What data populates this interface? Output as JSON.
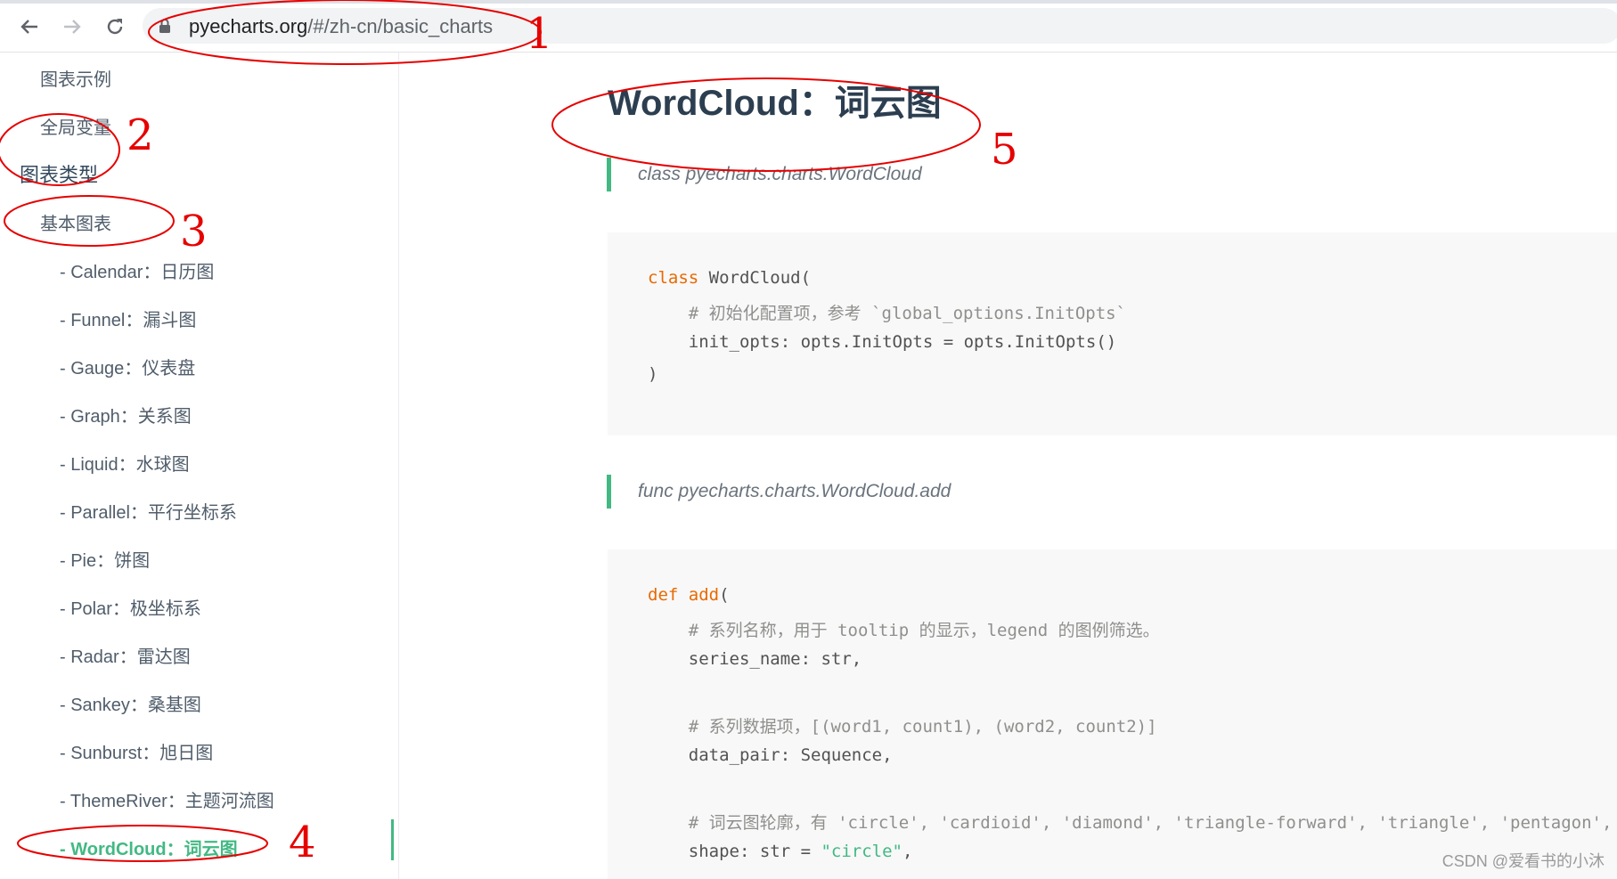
{
  "browser": {
    "back_icon": "arrow-left-icon",
    "forward_icon": "arrow-right-icon",
    "reload_icon": "reload-icon",
    "url_domain": "pyecharts.org",
    "url_path": "/#/zh-cn/basic_charts"
  },
  "sidebar": {
    "items": [
      {
        "label": "图表示例"
      },
      {
        "label": "全局变量"
      },
      {
        "label": "图表类型"
      },
      {
        "label": "基本图表"
      },
      {
        "label": "- Calendar：日历图"
      },
      {
        "label": "- Funnel：漏斗图"
      },
      {
        "label": "- Gauge：仪表盘"
      },
      {
        "label": "- Graph：关系图"
      },
      {
        "label": "- Liquid：水球图"
      },
      {
        "label": "- Parallel：平行坐标系"
      },
      {
        "label": "- Pie：饼图"
      },
      {
        "label": "- Polar：极坐标系"
      },
      {
        "label": "- Radar：雷达图"
      },
      {
        "label": "- Sankey：桑基图"
      },
      {
        "label": "- Sunburst：旭日图"
      },
      {
        "label": "- ThemeRiver：主题河流图"
      },
      {
        "label": "- WordCloud：词云图"
      }
    ]
  },
  "main": {
    "title": "WordCloud：词云图",
    "class_quote": "class pyecharts.charts.WordCloud",
    "func_quote": "func pyecharts.charts.WordCloud.add",
    "code1": {
      "l1_kw": "class",
      "l1_rest": " WordCloud(",
      "l2": "    # 初始化配置项，参考 `global_options.InitOpts`",
      "l3": "    init_opts: opts.InitOpts = opts.InitOpts()",
      "l4": ")"
    },
    "code2": {
      "l1_kw": "def",
      "l1_fn": " add",
      "l1_rest": "(",
      "l2": "    # 系列名称，用于 tooltip 的显示，legend 的图例筛选。",
      "l3": "    series_name: str,",
      "l4": "    # 系列数据项，[(word1, count1), (word2, count2)]",
      "l5": "    data_pair: Sequence,",
      "l6": "    # 词云图轮廓，有 'circle', 'cardioid', 'diamond', 'triangle-forward', 'triangle', 'pentagon',",
      "l7_a": "    shape: str = ",
      "l7_str": "\"circle\"",
      "l7_b": ","
    }
  },
  "annotations": {
    "n1": "1",
    "n2": "2",
    "n3": "3",
    "n4": "4",
    "n5": "5",
    "color": "#e60000"
  },
  "watermark": "CSDN @爱看书的小沐",
  "colors": {
    "accent": "#42b983",
    "keyword": "#e96900",
    "comment": "#8e908c"
  }
}
